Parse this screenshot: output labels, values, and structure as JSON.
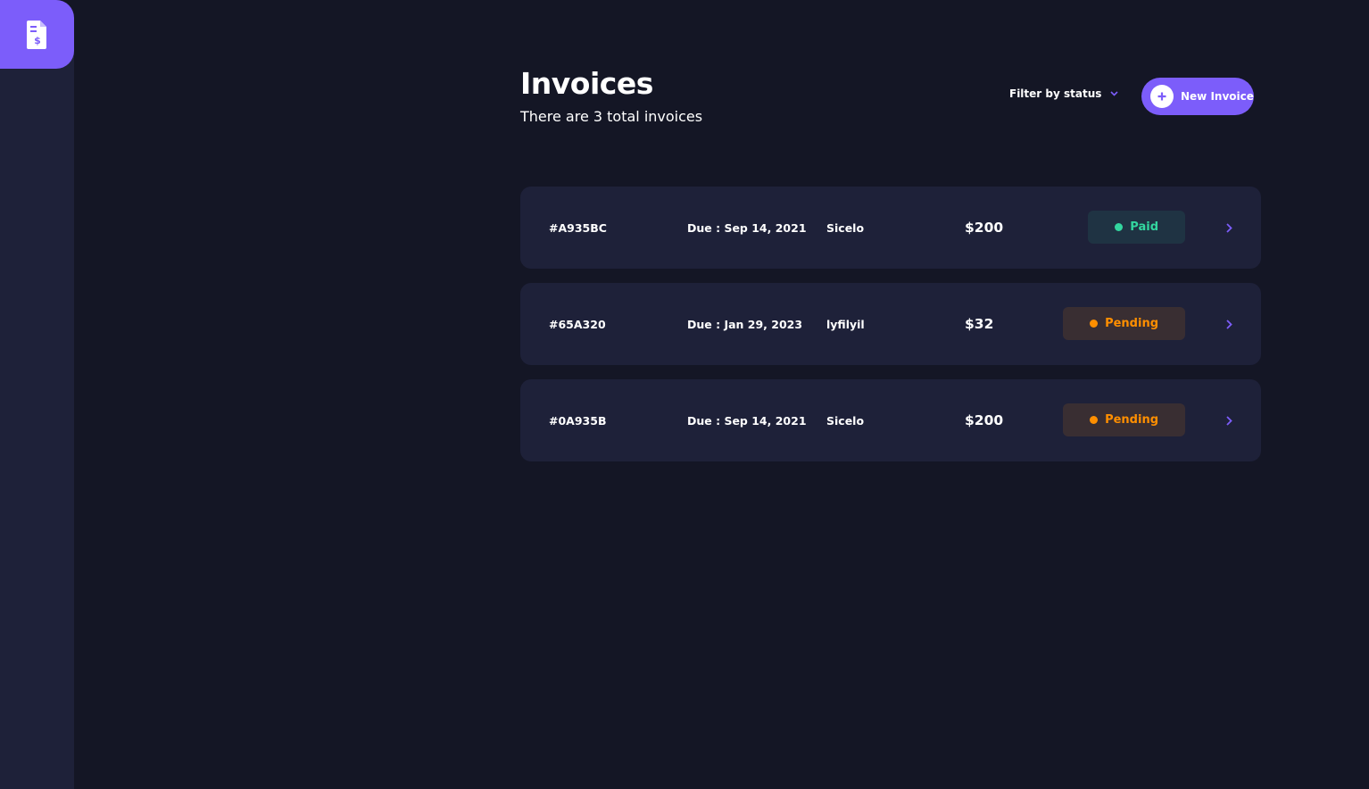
{
  "app": {
    "logo_icon": "invoice-dollar-icon",
    "accent": "#7c5dfa"
  },
  "header": {
    "title": "Invoices",
    "subtitle": "There are 3 total invoices",
    "filter_label": "Filter by status",
    "new_invoice_label": "New Invoice"
  },
  "invoices": [
    {
      "id": "#A935BC",
      "due": "Due : Sep 14, 2021",
      "client": "Sicelo",
      "amount": "$200",
      "status": "Paid"
    },
    {
      "id": "#65A320",
      "due": "Due : Jan 29, 2023",
      "client": "lyfilyil",
      "amount": "$32",
      "status": "Pending"
    },
    {
      "id": "#0A935B",
      "due": "Due : Sep 14, 2021",
      "client": "Sicelo",
      "amount": "$200",
      "status": "Pending"
    }
  ],
  "colors": {
    "paid": "#33d69f",
    "pending": "#ff8f00",
    "background": "#141625",
    "card": "#1e2139"
  }
}
